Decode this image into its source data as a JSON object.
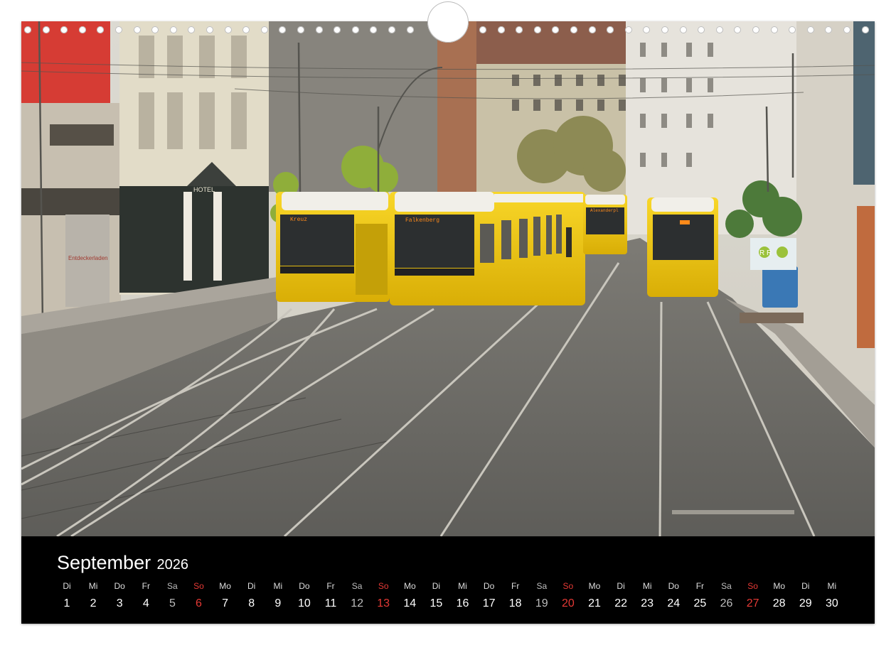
{
  "calendar": {
    "month": "September",
    "year": "2026",
    "weekdays": [
      "Di",
      "Mi",
      "Do",
      "Fr",
      "Sa",
      "So",
      "Mo",
      "Di",
      "Mi",
      "Do",
      "Fr",
      "Sa",
      "So",
      "Mo",
      "Di",
      "Mi",
      "Do",
      "Fr",
      "Sa",
      "So",
      "Mo",
      "Di",
      "Mi",
      "Do",
      "Fr",
      "Sa",
      "So",
      "Mo",
      "Di",
      "Mi"
    ],
    "days": [
      "1",
      "2",
      "3",
      "4",
      "5",
      "6",
      "7",
      "8",
      "9",
      "10",
      "11",
      "12",
      "13",
      "14",
      "15",
      "16",
      "17",
      "18",
      "19",
      "20",
      "21",
      "22",
      "23",
      "24",
      "25",
      "26",
      "27",
      "28",
      "29",
      "30"
    ],
    "sunday_color": "#e53935",
    "saturday_color": "#bdbdbd"
  },
  "photo": {
    "sign_hotel": "HOTEL",
    "sign_shop": "Entdeckerladen",
    "tram_1_display": "Kreuz",
    "tram_2_display": "Falkenberg",
    "tram_3_display": "Alexanderpl",
    "tram_color": "#f2c80f",
    "bin_logo": "R R"
  },
  "colors": {
    "frame": "#000000",
    "background": "#ffffff"
  }
}
